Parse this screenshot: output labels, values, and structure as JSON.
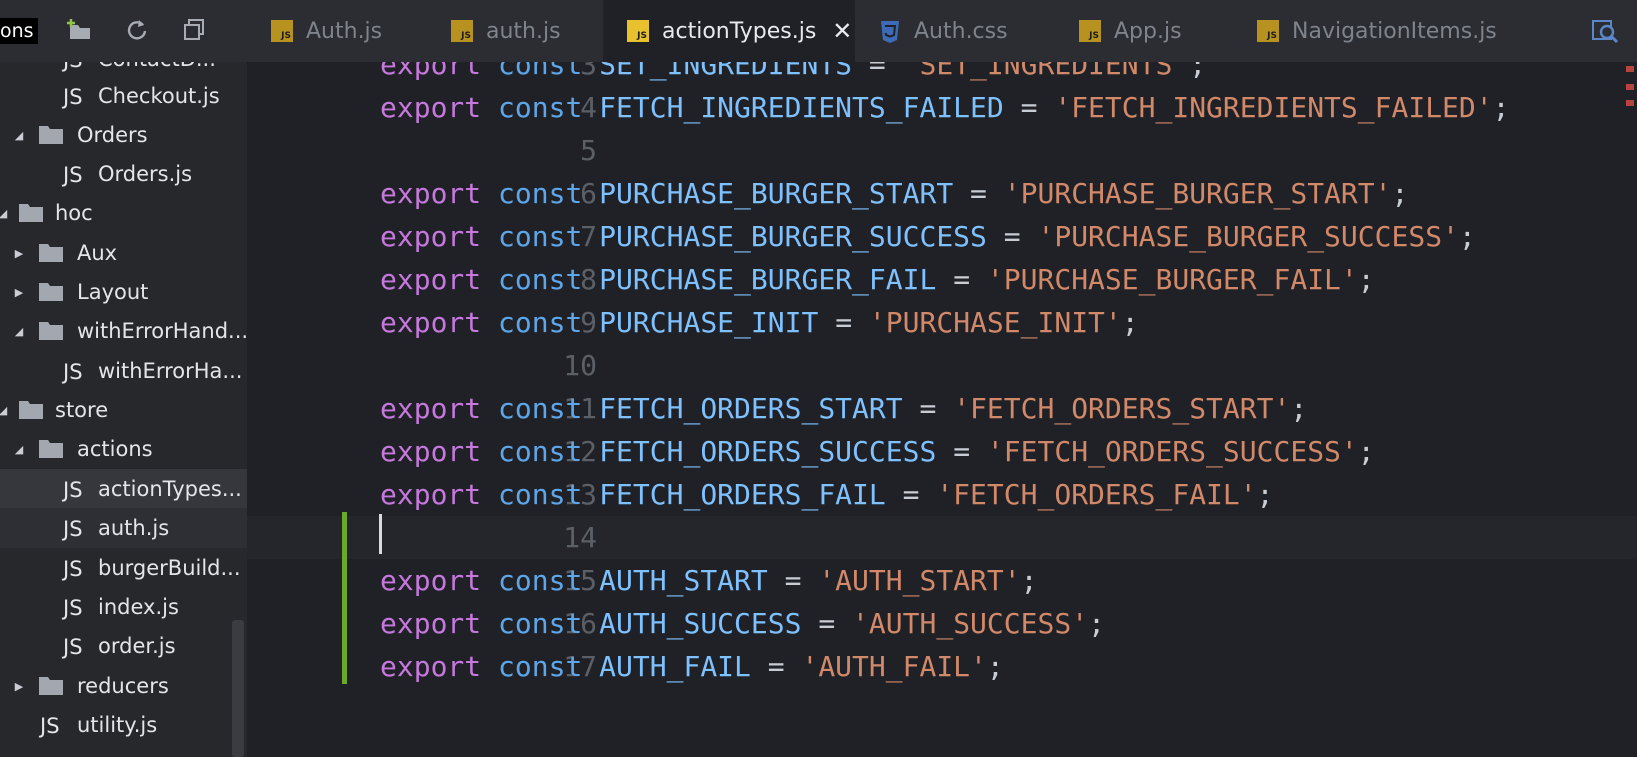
{
  "overlay": {
    "cut_label": "ons"
  },
  "tabs": [
    {
      "label": "Auth.js",
      "icon": "js-file-icon",
      "active": false
    },
    {
      "label": "auth.js",
      "icon": "js-file-icon",
      "active": false
    },
    {
      "label": "actionTypes.js",
      "icon": "js-file-icon",
      "active": true
    },
    {
      "label": "Auth.css",
      "icon": "css-file-icon",
      "active": false
    },
    {
      "label": "App.js",
      "icon": "js-file-icon",
      "active": false
    },
    {
      "label": "NavigationItems.js",
      "icon": "js-file-icon",
      "active": false
    }
  ],
  "tab_close_glyph": "✕",
  "icon_badge": {
    "js": "JS"
  },
  "sidebar": {
    "items": [
      {
        "label": "ContactD...",
        "type": "file",
        "depth": 3
      },
      {
        "label": "Checkout.js",
        "type": "file",
        "depth": 3
      },
      {
        "label": "Orders",
        "type": "folder",
        "expanded": true,
        "depth": 2
      },
      {
        "label": "Orders.js",
        "type": "file",
        "depth": 3
      },
      {
        "label": "hoc",
        "type": "folder",
        "expanded": true,
        "depth": 1
      },
      {
        "label": "Aux",
        "type": "folder",
        "expanded": false,
        "depth": 2
      },
      {
        "label": "Layout",
        "type": "folder",
        "expanded": false,
        "depth": 2
      },
      {
        "label": "withErrorHand...",
        "type": "folder",
        "expanded": true,
        "depth": 2
      },
      {
        "label": "withErrorHa...",
        "type": "file",
        "depth": 3
      },
      {
        "label": "store",
        "type": "folder",
        "expanded": true,
        "depth": 1
      },
      {
        "label": "actions",
        "type": "folder",
        "expanded": true,
        "depth": 2
      },
      {
        "label": "actionTypes...",
        "type": "file",
        "depth": 3,
        "selected": true
      },
      {
        "label": "auth.js",
        "type": "file",
        "depth": 3
      },
      {
        "label": "burgerBuild...",
        "type": "file",
        "depth": 3
      },
      {
        "label": "index.js",
        "type": "file",
        "depth": 3
      },
      {
        "label": "order.js",
        "type": "file",
        "depth": 3
      },
      {
        "label": "reducers",
        "type": "folder",
        "expanded": false,
        "depth": 2
      },
      {
        "label": "utility.js",
        "type": "file",
        "depth": 2
      }
    ]
  },
  "editor": {
    "current_line": "14",
    "lines": [
      {
        "n": "3",
        "kw": "export",
        "kw2": "const",
        "id": "SET_INGREDIENTS",
        "str": "'SET_INGREDIENTS'"
      },
      {
        "n": "4",
        "kw": "export",
        "kw2": "const",
        "id": "FETCH_INGREDIENTS_FAILED",
        "str": "'FETCH_INGREDIENTS_FAILED'"
      },
      {
        "n": "5"
      },
      {
        "n": "6",
        "kw": "export",
        "kw2": "const",
        "id": "PURCHASE_BURGER_START",
        "str": "'PURCHASE_BURGER_START'"
      },
      {
        "n": "7",
        "kw": "export",
        "kw2": "const",
        "id": "PURCHASE_BURGER_SUCCESS",
        "str": "'PURCHASE_BURGER_SUCCESS'"
      },
      {
        "n": "8",
        "kw": "export",
        "kw2": "const",
        "id": "PURCHASE_BURGER_FAIL",
        "str": "'PURCHASE_BURGER_FAIL'"
      },
      {
        "n": "9",
        "kw": "export",
        "kw2": "const",
        "id": "PURCHASE_INIT",
        "str": "'PURCHASE_INIT'"
      },
      {
        "n": "10"
      },
      {
        "n": "11",
        "kw": "export",
        "kw2": "const",
        "id": "FETCH_ORDERS_START",
        "str": "'FETCH_ORDERS_START'"
      },
      {
        "n": "12",
        "kw": "export",
        "kw2": "const",
        "id": "FETCH_ORDERS_SUCCESS",
        "str": "'FETCH_ORDERS_SUCCESS'"
      },
      {
        "n": "13",
        "kw": "export",
        "kw2": "const",
        "id": "FETCH_ORDERS_FAIL",
        "str": "'FETCH_ORDERS_FAIL'"
      },
      {
        "n": "14"
      },
      {
        "n": "15",
        "kw": "export",
        "kw2": "const",
        "id": "AUTH_START",
        "str": "'AUTH_START'"
      },
      {
        "n": "16",
        "kw": "export",
        "kw2": "const",
        "id": "AUTH_SUCCESS",
        "str": "'AUTH_SUCCESS'"
      },
      {
        "n": "17",
        "kw": "export",
        "kw2": "const",
        "id": "AUTH_FAIL",
        "str": "'AUTH_FAIL'"
      }
    ],
    "operator": "=",
    "terminator": ";"
  },
  "colors": {
    "keyword": "#c678dd",
    "storage": "#5ea6e8",
    "identifier": "#7fc1ff",
    "string": "#d1896a",
    "js_badge": "#e8c12e",
    "git_added": "#6aa92a"
  }
}
